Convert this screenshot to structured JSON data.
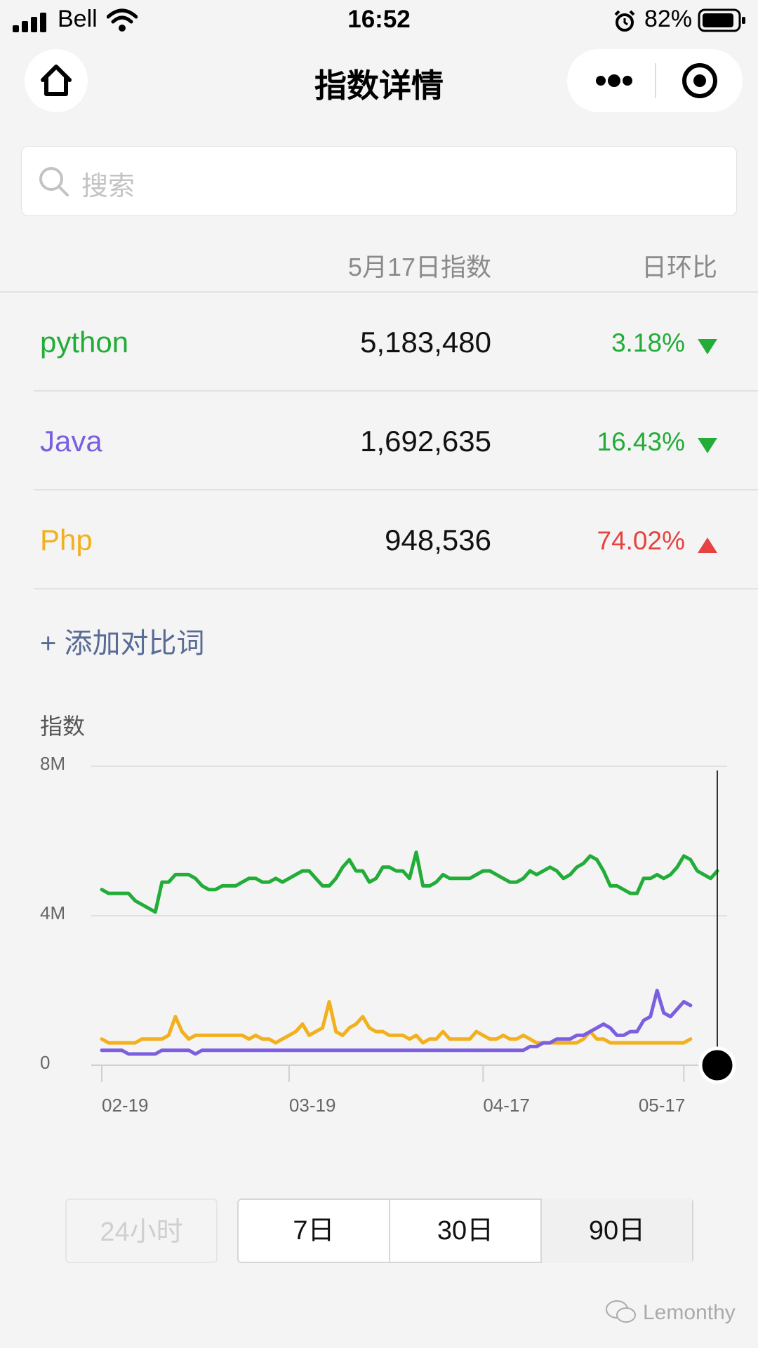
{
  "status_bar": {
    "carrier": "Bell",
    "time": "16:52",
    "battery": "82%"
  },
  "nav": {
    "title": "指数详情"
  },
  "search": {
    "placeholder": "搜索"
  },
  "table": {
    "col_index": "5月17日指数",
    "col_change": "日环比",
    "rows": [
      {
        "term": "python",
        "value": "5,183,480",
        "change": "3.18%",
        "dir": "down",
        "term_color": "#22ac38",
        "change_color": "#22ac38"
      },
      {
        "term": "Java",
        "value": "1,692,635",
        "change": "16.43%",
        "dir": "down",
        "term_color": "#7b5fe0",
        "change_color": "#22ac38"
      },
      {
        "term": "Php",
        "value": "948,536",
        "change": "74.02%",
        "dir": "up",
        "term_color": "#f2b01e",
        "change_color": "#e64340"
      }
    ]
  },
  "add_compare": "+ 添加对比词",
  "chart_data": {
    "type": "line",
    "ylabel": "指数",
    "ylim": [
      0,
      8000000
    ],
    "y_ticks": [
      "8M",
      "4M",
      "0"
    ],
    "x_ticks": [
      "02-19",
      "03-19",
      "04-17",
      "05-17"
    ],
    "x_tick_index": [
      0,
      28,
      57,
      87
    ],
    "series": [
      {
        "name": "python",
        "color": "#22ac38",
        "values": [
          4.7,
          4.6,
          4.6,
          4.6,
          4.6,
          4.4,
          4.3,
          4.2,
          4.1,
          4.9,
          4.9,
          5.1,
          5.1,
          5.1,
          5.0,
          4.8,
          4.7,
          4.7,
          4.8,
          4.8,
          4.8,
          4.9,
          5.0,
          5.0,
          4.9,
          4.9,
          5.0,
          4.9,
          5.0,
          5.1,
          5.2,
          5.2,
          5.0,
          4.8,
          4.8,
          5.0,
          5.3,
          5.5,
          5.2,
          5.2,
          4.9,
          5.0,
          5.3,
          5.3,
          5.2,
          5.2,
          5.0,
          5.7,
          4.8,
          4.8,
          4.9,
          5.1,
          5.0,
          5.0,
          5.0,
          5.0,
          5.1,
          5.2,
          5.2,
          5.1,
          5.0,
          4.9,
          4.9,
          5.0,
          5.2,
          5.1,
          5.2,
          5.3,
          5.2,
          5.0,
          5.1,
          5.3,
          5.4,
          5.6,
          5.5,
          5.2,
          4.8,
          4.8,
          4.7,
          4.6,
          4.6,
          5.0,
          5.0,
          5.1,
          5.0,
          5.1,
          5.3,
          5.6,
          5.5,
          5.2,
          5.1,
          5.0,
          5.2
        ]
      },
      {
        "name": "Java",
        "color": "#7b5fe0",
        "values": [
          0.4,
          0.4,
          0.4,
          0.4,
          0.3,
          0.3,
          0.3,
          0.3,
          0.3,
          0.4,
          0.4,
          0.4,
          0.4,
          0.4,
          0.3,
          0.4,
          0.4,
          0.4,
          0.4,
          0.4,
          0.4,
          0.4,
          0.4,
          0.4,
          0.4,
          0.4,
          0.4,
          0.4,
          0.4,
          0.4,
          0.4,
          0.4,
          0.4,
          0.4,
          0.4,
          0.4,
          0.4,
          0.4,
          0.4,
          0.4,
          0.4,
          0.4,
          0.4,
          0.4,
          0.4,
          0.4,
          0.4,
          0.4,
          0.4,
          0.4,
          0.4,
          0.4,
          0.4,
          0.4,
          0.4,
          0.4,
          0.4,
          0.4,
          0.4,
          0.4,
          0.4,
          0.4,
          0.4,
          0.4,
          0.5,
          0.5,
          0.6,
          0.6,
          0.7,
          0.7,
          0.7,
          0.8,
          0.8,
          0.9,
          1.0,
          1.1,
          1.0,
          0.8,
          0.8,
          0.9,
          0.9,
          1.2,
          1.3,
          2.0,
          1.4,
          1.3,
          1.5,
          1.7,
          1.6
        ]
      },
      {
        "name": "Php",
        "color": "#f2b01e",
        "values": [
          0.7,
          0.6,
          0.6,
          0.6,
          0.6,
          0.6,
          0.7,
          0.7,
          0.7,
          0.7,
          0.8,
          1.3,
          0.9,
          0.7,
          0.8,
          0.8,
          0.8,
          0.8,
          0.8,
          0.8,
          0.8,
          0.8,
          0.7,
          0.8,
          0.7,
          0.7,
          0.6,
          0.7,
          0.8,
          0.9,
          1.1,
          0.8,
          0.9,
          1.0,
          1.7,
          0.9,
          0.8,
          1.0,
          1.1,
          1.3,
          1.0,
          0.9,
          0.9,
          0.8,
          0.8,
          0.8,
          0.7,
          0.8,
          0.6,
          0.7,
          0.7,
          0.9,
          0.7,
          0.7,
          0.7,
          0.7,
          0.9,
          0.8,
          0.7,
          0.7,
          0.8,
          0.7,
          0.7,
          0.8,
          0.7,
          0.6,
          0.6,
          0.6,
          0.6,
          0.6,
          0.6,
          0.6,
          0.7,
          0.9,
          0.7,
          0.7,
          0.6,
          0.6,
          0.6,
          0.6,
          0.6,
          0.6,
          0.6,
          0.6,
          0.6,
          0.6,
          0.6,
          0.6,
          0.7
        ]
      }
    ]
  },
  "ranges": {
    "h24": "24小时",
    "d7": "7日",
    "d30": "30日",
    "d90": "90日",
    "selected": "90日"
  },
  "watermark": "Lemonthy"
}
